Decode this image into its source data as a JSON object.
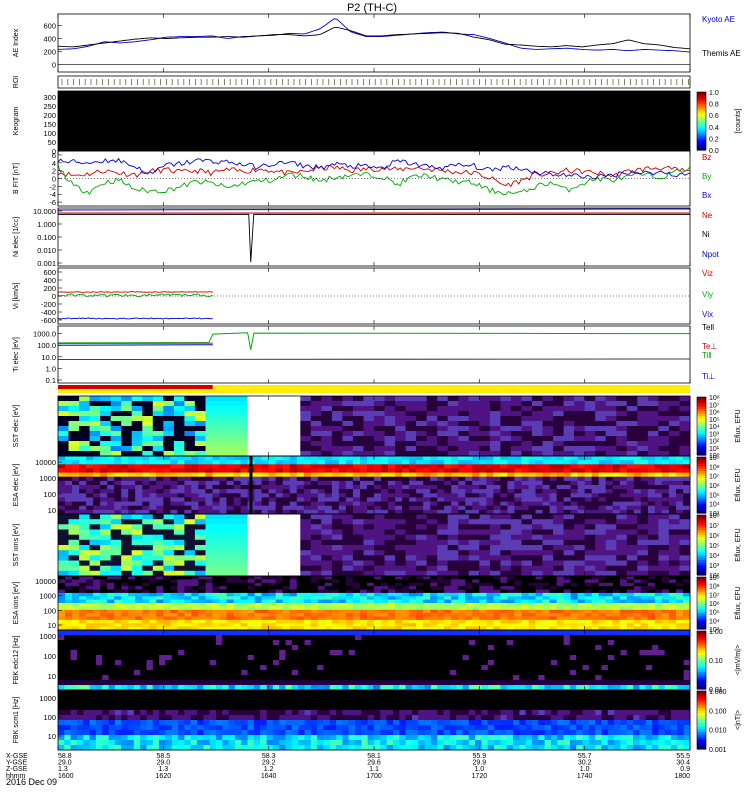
{
  "chart_data": {
    "type": "heatmap",
    "title": "P2 (TH-C)",
    "date_label": "2016 Dec 09",
    "time_ticks": [
      "1600",
      "1620",
      "1640",
      "1700",
      "1720",
      "1740",
      "1800"
    ],
    "ephemeris": {
      "labels": [
        "X-GSE",
        "Y-GSE",
        "Z-GSE",
        "hhmm"
      ],
      "x_gse": [
        "58.8",
        "58.5",
        "58.3",
        "58.1",
        "55.9",
        "55.7",
        "55.5"
      ],
      "y_gse": [
        "29.0",
        "29.0",
        "29.2",
        "29.6",
        "29.9",
        "30.2",
        "30.4"
      ],
      "z_gse": [
        "1.3",
        "1.3",
        "1.2",
        "1.1",
        "1.0",
        "1.0",
        "0.9"
      ]
    },
    "panels": [
      {
        "id": "ae",
        "ylabel": "AE Index",
        "yticks": [
          "600",
          "400",
          "200",
          "0"
        ],
        "legend": [
          {
            "name": "Kyoto AE",
            "color": "#0000cc"
          },
          {
            "name": "Themis AE",
            "color": "#000000"
          }
        ],
        "series": [
          {
            "name": "Kyoto AE",
            "color": "#0000cc",
            "values": [
              230,
              240,
              280,
              350,
              330,
              350,
              380,
              420,
              430,
              430,
              440,
              400,
              430,
              440,
              450,
              480,
              470,
              550,
              720,
              500,
              430,
              430,
              450,
              470,
              490,
              500,
              470,
              460,
              400,
              330,
              250,
              230,
              240,
              250,
              230,
              220,
              230,
              210,
              230,
              220,
              210,
              190
            ]
          },
          {
            "name": "Themis AE",
            "color": "#000000",
            "values": [
              280,
              270,
              300,
              330,
              360,
              390,
              410,
              400,
              410,
              420,
              420,
              430,
              420,
              440,
              460,
              460,
              440,
              460,
              580,
              520,
              440,
              440,
              460,
              470,
              480,
              490,
              480,
              420,
              380,
              310,
              300,
              280,
              270,
              290,
              270,
              300,
              320,
              380,
              320,
              300,
              260,
              240
            ]
          }
        ]
      },
      {
        "id": "roi",
        "ylabel": "ROI"
      },
      {
        "id": "keogram",
        "ylabel": "Keogram",
        "yticks": [
          "300",
          "250",
          "200",
          "150",
          "100",
          "50",
          "0"
        ],
        "colorbar": {
          "label": "[counts]",
          "ticks": [
            "1.0",
            "0.8",
            "0.6",
            "0.4",
            "0.2",
            "0.0"
          ]
        }
      },
      {
        "id": "bfield",
        "ylabel": "B FIT [nT]",
        "yticks": [
          "6",
          "4",
          "2",
          "0",
          "-2",
          "-4",
          "-6"
        ],
        "legend": [
          {
            "name": "Bz",
            "color": "#cc0000"
          },
          {
            "name": "By",
            "color": "#00aa00"
          },
          {
            "name": "Bx",
            "color": "#0000cc"
          }
        ],
        "series": [
          {
            "name": "Bz",
            "color": "#cc0000",
            "values": [
              1.6,
              0.8,
              1.2,
              2.0,
              1.4,
              1.0,
              1.8,
              2.2,
              1.6,
              2.0,
              1.4,
              2.2,
              1.8,
              2.4,
              2.0,
              1.2,
              1.8,
              2.6,
              2.8,
              2.0,
              2.4,
              2.6,
              2.2,
              2.8,
              2.4,
              2.0,
              1.6,
              1.4,
              0.2,
              -1.8,
              -0.6,
              1.0,
              1.2,
              2.0,
              1.8,
              1.4,
              0.6,
              1.8,
              2.4,
              2.8,
              2.2,
              1.8
            ]
          },
          {
            "name": "By",
            "color": "#00aa00",
            "values": [
              3.0,
              -2.0,
              -3.4,
              -1.0,
              -0.4,
              -2.8,
              -3.2,
              -3.0,
              -2.0,
              -0.8,
              -1.2,
              -2.4,
              -1.2,
              -0.6,
              -0.4,
              1.0,
              0.6,
              -0.6,
              0.4,
              0.8,
              1.0,
              0.6,
              -1.6,
              0.4,
              0.8,
              -0.4,
              -0.8,
              -1.2,
              -3.0,
              -3.6,
              -3.8,
              -2.0,
              -1.0,
              -3.0,
              -1.2,
              0.0,
              -0.4,
              0.4,
              1.0,
              0.2,
              1.6,
              2.6
            ]
          },
          {
            "name": "Bx",
            "color": "#0000cc",
            "values": [
              4.4,
              4.2,
              4.0,
              4.6,
              4.6,
              3.0,
              1.0,
              3.4,
              3.8,
              4.6,
              4.4,
              4.2,
              3.6,
              2.8,
              3.8,
              4.0,
              3.2,
              2.8,
              3.6,
              3.2,
              3.0,
              2.6,
              4.4,
              3.8,
              3.0,
              2.8,
              3.4,
              3.2,
              2.0,
              3.0,
              2.6,
              1.6,
              1.2,
              0.8,
              0.6,
              0.4,
              0.8,
              1.8,
              1.4,
              1.6,
              1.0,
              1.2
            ]
          }
        ]
      },
      {
        "id": "density",
        "ylabel": "Ni elec [1/cc]",
        "yticks": [
          "10.000",
          "1.000",
          "0.100",
          "0.010",
          "0.001"
        ],
        "legend": [
          {
            "name": "Ne",
            "color": "#cc0000"
          },
          {
            "name": "Ni",
            "color": "#000000"
          },
          {
            "name": "Npot",
            "color": "#0000cc"
          }
        ]
      },
      {
        "id": "velocity",
        "ylabel": "Vi [km/s]",
        "yticks": [
          "600",
          "400",
          "200",
          "0",
          "-200",
          "-400",
          "-600"
        ],
        "legend": [
          {
            "name": "Viz",
            "color": "#cc0000"
          },
          {
            "name": "Viy",
            "color": "#00aa00"
          },
          {
            "name": "Vix",
            "color": "#0000cc"
          }
        ]
      },
      {
        "id": "temperature",
        "ylabel": "Ti elec [eV]",
        "yticks": [
          "1000.0",
          "100.0",
          "10.0",
          "1.0",
          "0.1"
        ],
        "legend": [
          {
            "name": "Tell",
            "color": "#000000"
          },
          {
            "name": "Te⊥",
            "color": "#cc0000"
          },
          {
            "name": "Ti‖",
            "color": "#00aa00"
          },
          {
            "name": "Ti⊥",
            "color": "#0000cc"
          }
        ]
      },
      {
        "id": "sst_elec",
        "ylabel": "SST elec [eV]",
        "colorbar": {
          "label": "Eflux, EFU",
          "ticks": [
            "10⁸",
            "10⁷",
            "10⁶",
            "10⁵",
            "10⁴",
            "10³",
            "10²",
            "10¹",
            "10⁰"
          ]
        }
      },
      {
        "id": "esa_elec",
        "ylabel": "ESA elec [eV]",
        "yticks": [
          "10000",
          "1000",
          "100",
          "10"
        ],
        "colorbar": {
          "label": "Eflux, EFU",
          "ticks": [
            "10⁹",
            "10⁸",
            "10⁷",
            "10⁶",
            "10⁵",
            "10⁴",
            "10³"
          ]
        }
      },
      {
        "id": "sst_ion",
        "ylabel": "SST ions [eV]",
        "colorbar": {
          "label": "Eflux, EFU",
          "ticks": [
            "10⁸",
            "10⁷",
            "10⁶",
            "10⁵",
            "10⁴",
            "10³",
            "10²"
          ]
        }
      },
      {
        "id": "esa_ion",
        "ylabel": "ESA ions [eV]",
        "yticks": [
          "10000",
          "1000",
          "100",
          "10"
        ],
        "colorbar": {
          "label": "Eflux, EFU",
          "ticks": [
            "10⁹",
            "10⁸",
            "10⁷",
            "10⁶",
            "10⁵",
            "10⁴",
            "10³"
          ]
        }
      },
      {
        "id": "fbk_e",
        "ylabel": "FBK edc12 [Hz]",
        "yticks": [
          "1000",
          "100",
          "10"
        ],
        "colorbar": {
          "label": "<|mV/m|>",
          "ticks": [
            "1.00",
            "0.10",
            "0.01"
          ]
        }
      },
      {
        "id": "fbk_b",
        "ylabel": "FBK scm1 [Hz]",
        "yticks": [
          "1000",
          "100",
          "10"
        ],
        "colorbar": {
          "label": "<|nT|>",
          "ticks": [
            "1.000",
            "0.100",
            "0.010",
            "0.001"
          ]
        }
      }
    ]
  }
}
